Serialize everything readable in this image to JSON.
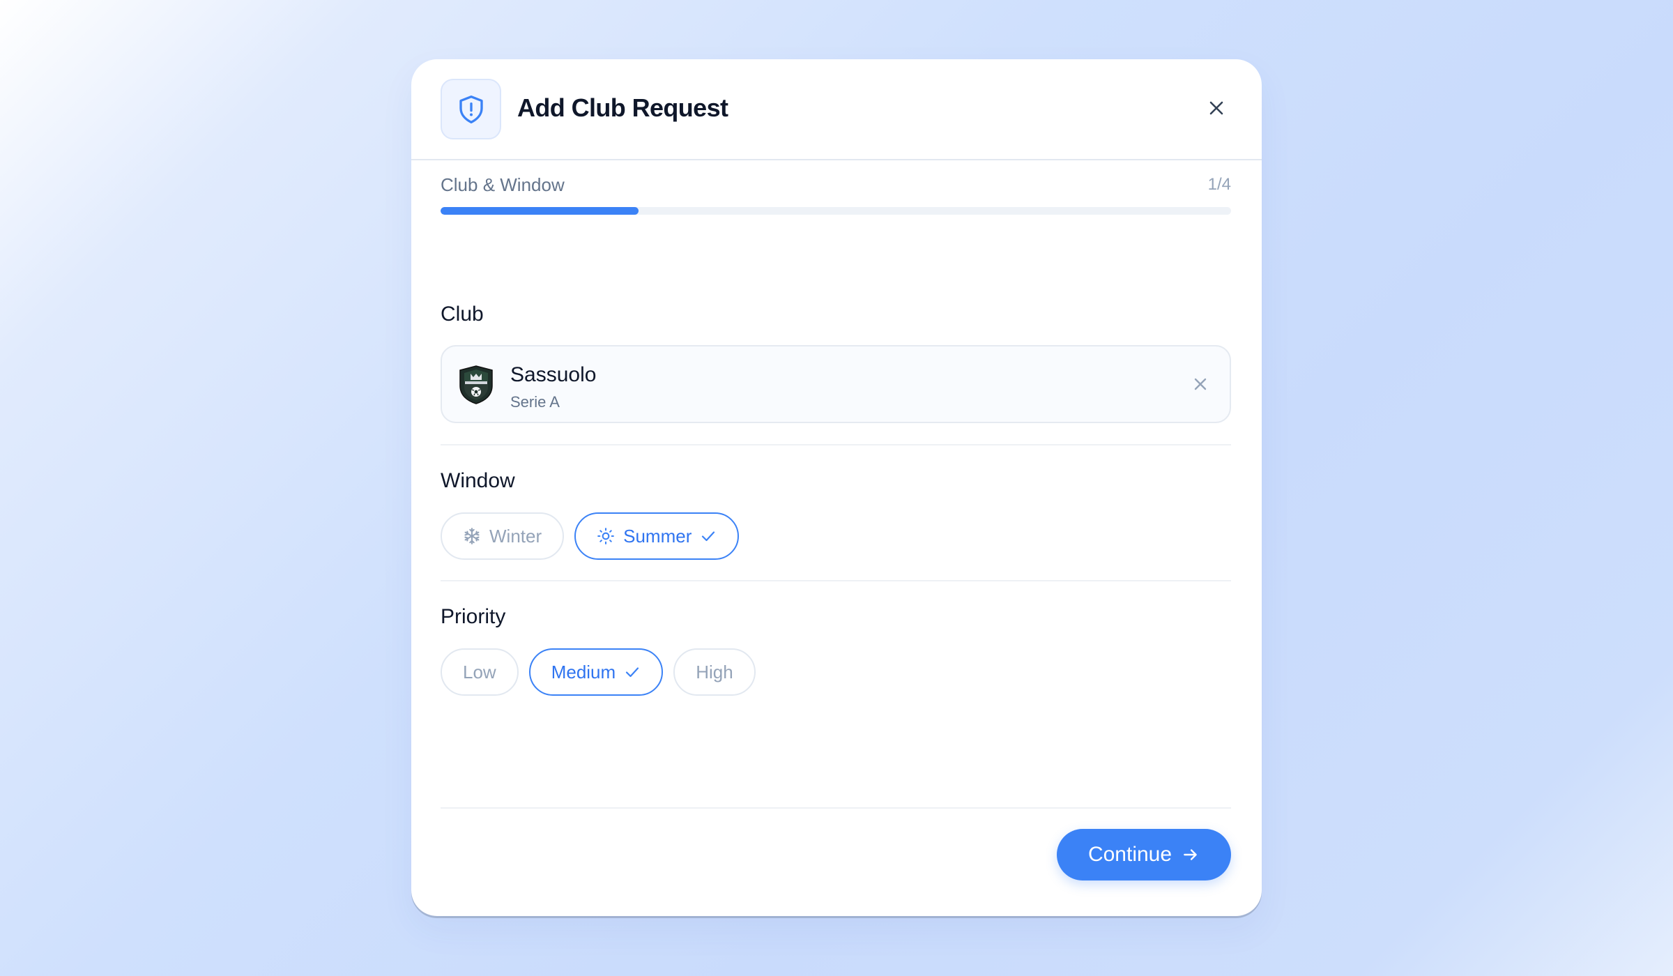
{
  "dialog": {
    "title": "Add Club Request",
    "header_icon": "shield-alert-icon",
    "close_icon": "close-icon"
  },
  "progress": {
    "step_label": "Club & Window",
    "step_count": "1/4",
    "fraction": 0.25
  },
  "club_section": {
    "label": "Club",
    "selected": {
      "name": "Sassuolo",
      "league": "Serie A",
      "crest_icon": "club-crest-icon",
      "clear_icon": "clear-icon"
    }
  },
  "window_section": {
    "label": "Window",
    "options": [
      {
        "label": "Winter",
        "icon": "snowflake-icon",
        "selected": false
      },
      {
        "label": "Summer",
        "icon": "sun-icon",
        "selected": true
      }
    ]
  },
  "priority_section": {
    "label": "Priority",
    "options": [
      {
        "label": "Low",
        "selected": false
      },
      {
        "label": "Medium",
        "selected": true
      },
      {
        "label": "High",
        "selected": false
      }
    ]
  },
  "footer": {
    "continue_label": "Continue",
    "continue_icon": "arrow-right-icon"
  },
  "colors": {
    "accent": "#3b82f6",
    "text_primary": "#0f172a",
    "text_muted": "#94a3b8"
  }
}
